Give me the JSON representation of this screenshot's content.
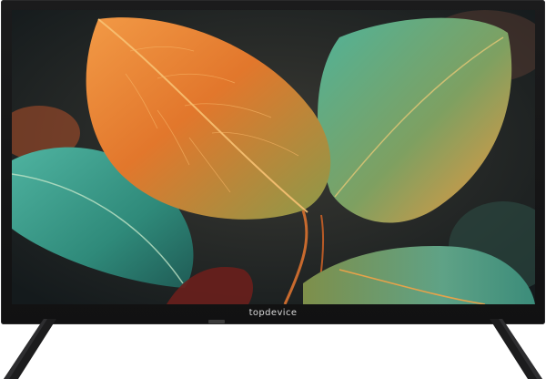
{
  "brand": {
    "logo_text": "topdevice"
  },
  "screen": {
    "content": "leaves-wallpaper"
  },
  "colors": {
    "bezel": "#151516",
    "leaf_orange": "#e07a2c",
    "leaf_teal": "#3a9a86",
    "background": "#ffffff"
  }
}
